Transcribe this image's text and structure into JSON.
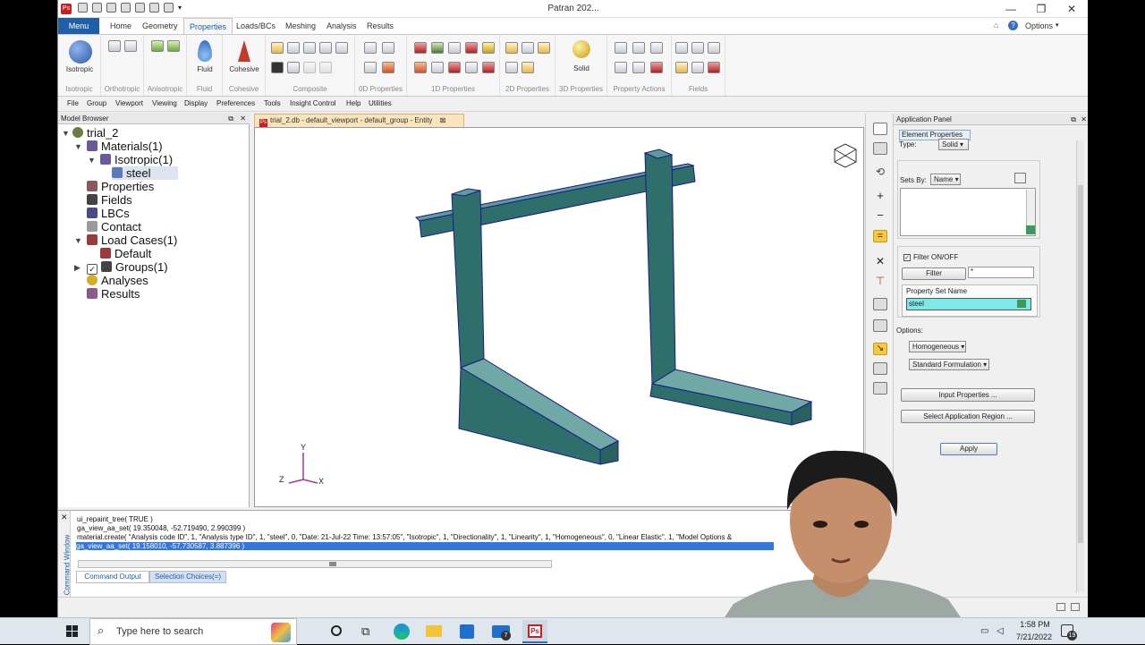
{
  "window": {
    "title": "Patran 202...",
    "controls": [
      "—",
      "❐",
      "✕"
    ]
  },
  "ribbon_tabs": [
    "Menu",
    "Home",
    "Geometry",
    "Properties",
    "Loads/BCs",
    "Meshing",
    "Analysis",
    "Results"
  ],
  "options_label": "Options",
  "ribbon": {
    "isotropic": "Isotropic",
    "fluid": "Fluid",
    "cohesive": "Cohesive",
    "solid": "Solid",
    "groups": [
      "Isotropic",
      "Orthotropic",
      "Anisotropic",
      "Fluid",
      "Cohesive",
      "Composite",
      "0D Properties",
      "1D Properties",
      "2D Properties",
      "3D Properties",
      "Property Actions",
      "Fields"
    ]
  },
  "menubar": [
    "File",
    "Group",
    "Viewport",
    "Viewing",
    "Display",
    "Preferences",
    "Tools",
    "Insight Control",
    "Help",
    "Utilities"
  ],
  "model_browser": {
    "title": "Model Browser",
    "items": [
      "trial_2",
      "Materials(1)",
      "Isotropic(1)",
      "steel",
      "Properties",
      "Fields",
      "LBCs",
      "Contact",
      "Load Cases(1)",
      "Default",
      "Groups(1)",
      "Analyses",
      "Results"
    ]
  },
  "viewport": {
    "tab": "trial_2.db - default_viewport - default_group - Entity",
    "axes": [
      "Y",
      "Z",
      "X"
    ]
  },
  "app_panel": {
    "title": "Application Panel",
    "tab": "Element Properties",
    "type_label": "Type:",
    "type_value": "Solid",
    "sets_by_label": "Sets By:",
    "sets_by_value": "Name",
    "filter_onoff": "Filter ON/OFF",
    "filter_button": "Filter",
    "filter_value": "*",
    "psn_label": "Property Set Name",
    "psn_value": "steel",
    "options_label": "Options:",
    "option1": "Homogeneous",
    "option2": "Standard Formulation",
    "input_props": "Input Properties ...",
    "select_region": "Select Application Region ...",
    "apply": "Apply"
  },
  "command": {
    "side_label": "Command Window",
    "lines": [
      "ui_repaint_tree( TRUE )",
      "ga_view_aa_set( 19.350048, -52.719490, 2.990399 )",
      "material.create( \"Analysis code ID\", 1, \"Analysis type ID\", 1, \"steel\", 0, \"Date: 21-Jul-22          Time: 13:57:05\", \"Isotropic\", 1, \"Directionality\", 1, \"Linearity\", 1, \"Homogeneous\", 0, \"Linear Elastic\", 1, \"Model Options &",
      "ga_view_aa_set( 19.158010, -57.730587, 3.887396 )"
    ],
    "tabs": [
      "Command Output",
      "Selection Choices(=)"
    ]
  },
  "taskbar": {
    "search_placeholder": "Type here to search",
    "time": "1:58 PM",
    "date": "7/21/2022",
    "notif_count": "19",
    "mail_badge": "7"
  },
  "colors": {
    "accent": "#1f5fa8",
    "beam": "#2e6f6c",
    "beam_top": "#5f9c99",
    "edge": "#1a1a8c",
    "selection": "#3377dd"
  }
}
